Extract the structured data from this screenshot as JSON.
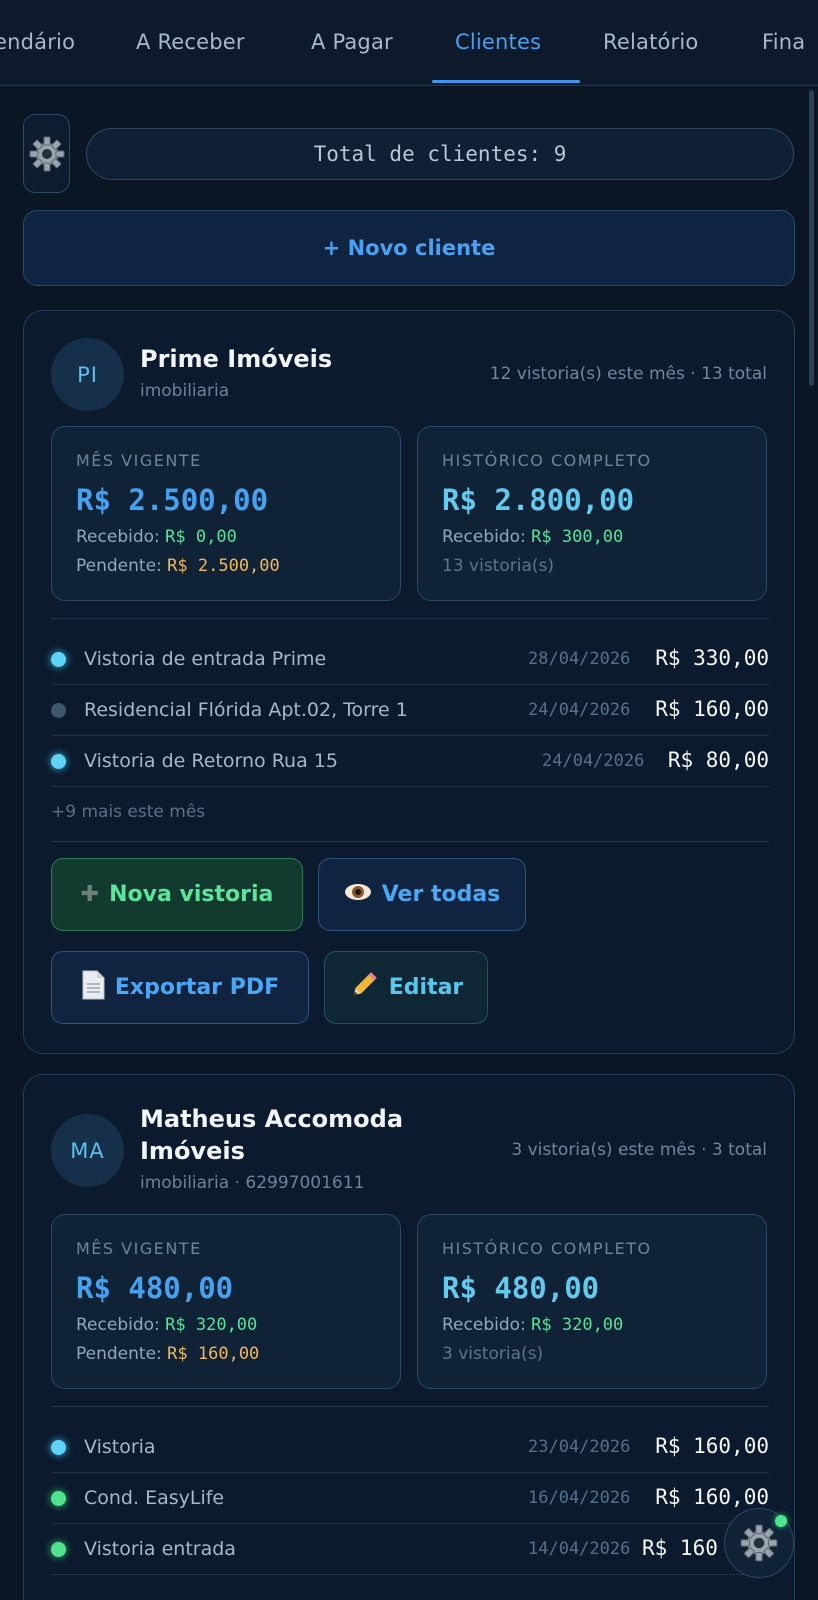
{
  "tabs": [
    {
      "label": "endário",
      "active": false
    },
    {
      "label": "A Receber",
      "active": false
    },
    {
      "label": "A Pagar",
      "active": false
    },
    {
      "label": "Clientes",
      "active": true
    },
    {
      "label": "Relatório",
      "active": false
    },
    {
      "label": "Fina",
      "active": false
    }
  ],
  "toolbar": {
    "total_label": "Total de clientes: 9",
    "new_client_label": "+ Novo cliente"
  },
  "clients": [
    {
      "initials": "PI",
      "name": "Prime Imóveis",
      "subtitle": "imobiliaria",
      "count": "12 vistoria(s) este mês · 13 total",
      "month": {
        "title": "MÊS VIGENTE",
        "amount": "R$ 2.500,00",
        "received_label": "Recebido:",
        "received_value": "R$ 0,00",
        "pending_label": "Pendente:",
        "pending_value": "R$ 2.500,00"
      },
      "history": {
        "title": "HISTÓRICO COMPLETO",
        "amount": "R$ 2.800,00",
        "received_label": "Recebido:",
        "received_value": "R$ 300,00",
        "inspections": "13 vistoria(s)"
      },
      "items": [
        {
          "name": "Vistoria de entrada Prime",
          "date": "28/04/2026",
          "value": "R$ 330,00",
          "status": "cyan"
        },
        {
          "name": "Residencial Flórida Apt.02, Torre 1",
          "date": "24/04/2026",
          "value": "R$ 160,00",
          "status": "gray"
        },
        {
          "name": "Vistoria de Retorno Rua 15",
          "date": "24/04/2026",
          "value": "R$ 80,00",
          "status": "cyan"
        }
      ],
      "more": "+9 mais este mês",
      "buttons": {
        "new": "Nova vistoria",
        "view": "Ver todas",
        "export": "Exportar PDF",
        "edit": "Editar"
      }
    },
    {
      "initials": "MA",
      "name_line1": "Matheus Accomoda",
      "name_line2": "Imóveis",
      "subtitle": "imobiliaria · 62997001611",
      "count": "3 vistoria(s) este mês · 3 total",
      "month": {
        "title": "MÊS VIGENTE",
        "amount": "R$ 480,00",
        "received_label": "Recebido:",
        "received_value": "R$ 320,00",
        "pending_label": "Pendente:",
        "pending_value": "R$ 160,00"
      },
      "history": {
        "title": "HISTÓRICO COMPLETO",
        "amount": "R$ 480,00",
        "received_label": "Recebido:",
        "received_value": "R$ 320,00",
        "inspections": "3 vistoria(s)"
      },
      "items": [
        {
          "name": "Vistoria",
          "date": "23/04/2026",
          "value": "R$ 160,00",
          "status": "cyan"
        },
        {
          "name": "Cond. EasyLife",
          "date": "16/04/2026",
          "value": "R$ 160,00",
          "status": "green"
        },
        {
          "name": "Vistoria entrada",
          "date": "14/04/2026",
          "value": "R$ 160",
          "status": "green"
        }
      ]
    }
  ],
  "icons": {
    "settings": "gear-icon",
    "new_inspection": "plus-icon",
    "view_all": "eye-icon",
    "export": "document-icon",
    "edit": "pencil-icon"
  },
  "colors": {
    "background": "#0a1624",
    "accent_blue": "#4a9ff0",
    "received_green": "#56e39a",
    "pending_orange": "#f2b85a"
  }
}
